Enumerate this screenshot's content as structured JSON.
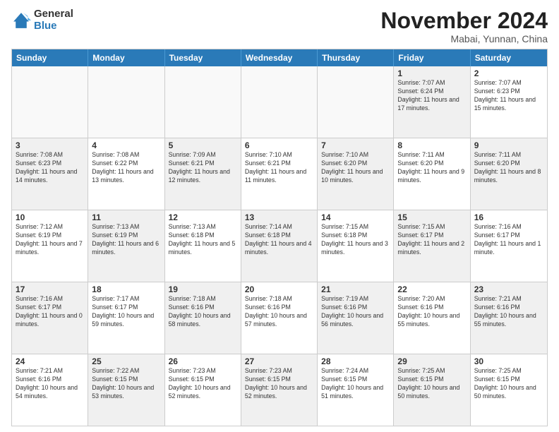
{
  "logo": {
    "general": "General",
    "blue": "Blue"
  },
  "title": "November 2024",
  "location": "Mabai, Yunnan, China",
  "weekdays": [
    "Sunday",
    "Monday",
    "Tuesday",
    "Wednesday",
    "Thursday",
    "Friday",
    "Saturday"
  ],
  "rows": [
    [
      {
        "day": "",
        "info": "",
        "empty": true
      },
      {
        "day": "",
        "info": "",
        "empty": true
      },
      {
        "day": "",
        "info": "",
        "empty": true
      },
      {
        "day": "",
        "info": "",
        "empty": true
      },
      {
        "day": "",
        "info": "",
        "empty": true
      },
      {
        "day": "1",
        "info": "Sunrise: 7:07 AM\nSunset: 6:24 PM\nDaylight: 11 hours and 17 minutes.",
        "shaded": true
      },
      {
        "day": "2",
        "info": "Sunrise: 7:07 AM\nSunset: 6:23 PM\nDaylight: 11 hours and 15 minutes.",
        "shaded": false
      }
    ],
    [
      {
        "day": "3",
        "info": "Sunrise: 7:08 AM\nSunset: 6:23 PM\nDaylight: 11 hours and 14 minutes.",
        "shaded": true
      },
      {
        "day": "4",
        "info": "Sunrise: 7:08 AM\nSunset: 6:22 PM\nDaylight: 11 hours and 13 minutes.",
        "shaded": false
      },
      {
        "day": "5",
        "info": "Sunrise: 7:09 AM\nSunset: 6:21 PM\nDaylight: 11 hours and 12 minutes.",
        "shaded": true
      },
      {
        "day": "6",
        "info": "Sunrise: 7:10 AM\nSunset: 6:21 PM\nDaylight: 11 hours and 11 minutes.",
        "shaded": false
      },
      {
        "day": "7",
        "info": "Sunrise: 7:10 AM\nSunset: 6:20 PM\nDaylight: 11 hours and 10 minutes.",
        "shaded": true
      },
      {
        "day": "8",
        "info": "Sunrise: 7:11 AM\nSunset: 6:20 PM\nDaylight: 11 hours and 9 minutes.",
        "shaded": false
      },
      {
        "day": "9",
        "info": "Sunrise: 7:11 AM\nSunset: 6:20 PM\nDaylight: 11 hours and 8 minutes.",
        "shaded": true
      }
    ],
    [
      {
        "day": "10",
        "info": "Sunrise: 7:12 AM\nSunset: 6:19 PM\nDaylight: 11 hours and 7 minutes.",
        "shaded": false
      },
      {
        "day": "11",
        "info": "Sunrise: 7:13 AM\nSunset: 6:19 PM\nDaylight: 11 hours and 6 minutes.",
        "shaded": true
      },
      {
        "day": "12",
        "info": "Sunrise: 7:13 AM\nSunset: 6:18 PM\nDaylight: 11 hours and 5 minutes.",
        "shaded": false
      },
      {
        "day": "13",
        "info": "Sunrise: 7:14 AM\nSunset: 6:18 PM\nDaylight: 11 hours and 4 minutes.",
        "shaded": true
      },
      {
        "day": "14",
        "info": "Sunrise: 7:15 AM\nSunset: 6:18 PM\nDaylight: 11 hours and 3 minutes.",
        "shaded": false
      },
      {
        "day": "15",
        "info": "Sunrise: 7:15 AM\nSunset: 6:17 PM\nDaylight: 11 hours and 2 minutes.",
        "shaded": true
      },
      {
        "day": "16",
        "info": "Sunrise: 7:16 AM\nSunset: 6:17 PM\nDaylight: 11 hours and 1 minute.",
        "shaded": false
      }
    ],
    [
      {
        "day": "17",
        "info": "Sunrise: 7:16 AM\nSunset: 6:17 PM\nDaylight: 11 hours and 0 minutes.",
        "shaded": true
      },
      {
        "day": "18",
        "info": "Sunrise: 7:17 AM\nSunset: 6:17 PM\nDaylight: 10 hours and 59 minutes.",
        "shaded": false
      },
      {
        "day": "19",
        "info": "Sunrise: 7:18 AM\nSunset: 6:16 PM\nDaylight: 10 hours and 58 minutes.",
        "shaded": true
      },
      {
        "day": "20",
        "info": "Sunrise: 7:18 AM\nSunset: 6:16 PM\nDaylight: 10 hours and 57 minutes.",
        "shaded": false
      },
      {
        "day": "21",
        "info": "Sunrise: 7:19 AM\nSunset: 6:16 PM\nDaylight: 10 hours and 56 minutes.",
        "shaded": true
      },
      {
        "day": "22",
        "info": "Sunrise: 7:20 AM\nSunset: 6:16 PM\nDaylight: 10 hours and 55 minutes.",
        "shaded": false
      },
      {
        "day": "23",
        "info": "Sunrise: 7:21 AM\nSunset: 6:16 PM\nDaylight: 10 hours and 55 minutes.",
        "shaded": true
      }
    ],
    [
      {
        "day": "24",
        "info": "Sunrise: 7:21 AM\nSunset: 6:16 PM\nDaylight: 10 hours and 54 minutes.",
        "shaded": false
      },
      {
        "day": "25",
        "info": "Sunrise: 7:22 AM\nSunset: 6:15 PM\nDaylight: 10 hours and 53 minutes.",
        "shaded": true
      },
      {
        "day": "26",
        "info": "Sunrise: 7:23 AM\nSunset: 6:15 PM\nDaylight: 10 hours and 52 minutes.",
        "shaded": false
      },
      {
        "day": "27",
        "info": "Sunrise: 7:23 AM\nSunset: 6:15 PM\nDaylight: 10 hours and 52 minutes.",
        "shaded": true
      },
      {
        "day": "28",
        "info": "Sunrise: 7:24 AM\nSunset: 6:15 PM\nDaylight: 10 hours and 51 minutes.",
        "shaded": false
      },
      {
        "day": "29",
        "info": "Sunrise: 7:25 AM\nSunset: 6:15 PM\nDaylight: 10 hours and 50 minutes.",
        "shaded": true
      },
      {
        "day": "30",
        "info": "Sunrise: 7:25 AM\nSunset: 6:15 PM\nDaylight: 10 hours and 50 minutes.",
        "shaded": false
      }
    ]
  ]
}
